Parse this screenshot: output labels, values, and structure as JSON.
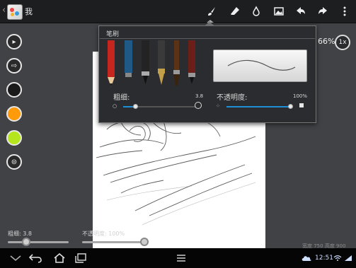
{
  "app": {
    "title": "我"
  },
  "toolbar": {
    "icons": [
      "brush-icon",
      "eraser-icon",
      "dropper-icon",
      "image-icon",
      "undo-icon",
      "redo-icon",
      "overflow-icon"
    ],
    "active": "brush-icon"
  },
  "left_tools": [
    {
      "name": "brush-style-1",
      "color": "#2a2a2a"
    },
    {
      "name": "brush-style-2",
      "color": "#2a2a2a"
    },
    {
      "name": "color-black",
      "color": "#1a1a1a"
    },
    {
      "name": "color-orange",
      "color": "#ff9b0a"
    },
    {
      "name": "color-lime",
      "color": "#b5e61d"
    },
    {
      "name": "brush-style-3",
      "color": "#2a2a2a"
    }
  ],
  "zoom": {
    "percent": "66%",
    "reset_label": "1x"
  },
  "brush_popup": {
    "title": "笔刷",
    "thickness": {
      "label": "粗细:",
      "value": "3.8",
      "level": 0.17
    },
    "opacity": {
      "label": "不透明度:",
      "value": "100%",
      "level": 1.0
    },
    "pens": [
      "red-pencil",
      "blue-pen",
      "black-marker",
      "fountain-pen",
      "flat-brush",
      "red-pen"
    ]
  },
  "bottom_sliders": {
    "thickness": {
      "label": "粗细: 3.8",
      "level": 0.17
    },
    "opacity": {
      "label": "不透明度: 100%",
      "level": 1.0
    }
  },
  "canvas_info": {
    "width_label": "宽度 750",
    "height_label": "高度 900"
  },
  "status": {
    "time": "12:51"
  },
  "colors": {
    "accent": "#1e8fd6",
    "orange": "#ff9b0a",
    "lime": "#b5e61d"
  }
}
